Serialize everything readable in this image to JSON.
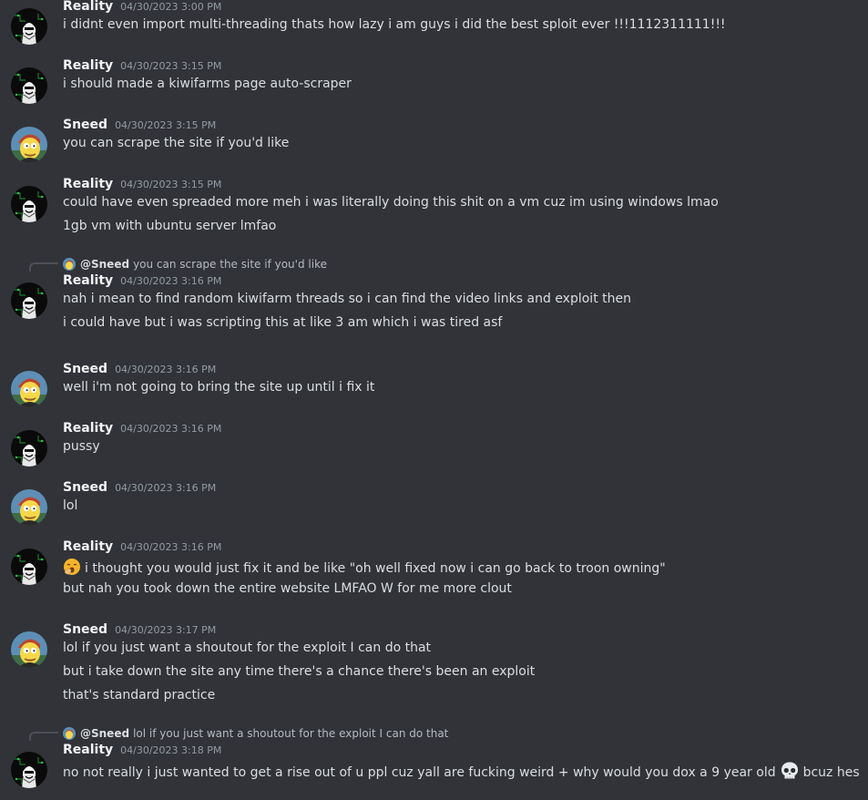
{
  "messages": [
    {
      "author": "Reality",
      "avatar": "reality",
      "timestamp": "04/30/2023 3:00 PM",
      "lines": [
        "i didnt even import multi-threading thats how lazy i am guys i did the best sploit ever !!!1112311111!!!"
      ]
    },
    {
      "author": "Reality",
      "avatar": "reality",
      "timestamp": "04/30/2023 3:15 PM",
      "lines": [
        "i should made a kiwifarms page auto-scraper"
      ]
    },
    {
      "author": "Sneed",
      "avatar": "sneed",
      "timestamp": "04/30/2023 3:15 PM",
      "lines": [
        "you can scrape the site if you'd like"
      ]
    },
    {
      "author": "Reality",
      "avatar": "reality",
      "timestamp": "04/30/2023 3:15 PM",
      "lines": [
        "could have even spreaded more meh i was literally doing this shit on a vm cuz im using windows lmao",
        "1gb vm with ubuntu server lmfao"
      ]
    },
    {
      "author": "Reality",
      "avatar": "reality",
      "timestamp": "04/30/2023 3:16 PM",
      "reply": {
        "name": "@Sneed",
        "text": "you can scrape the site if you'd like"
      },
      "lines": [
        "nah i mean to find random kiwifarm threads so i can find the video links and exploit then",
        "i could have but i was scripting this at like 3 am which i was tired asf"
      ]
    },
    {
      "author": "Sneed",
      "avatar": "sneed",
      "timestamp": "04/30/2023 3:16 PM",
      "lines": [
        "well i'm not going to bring the site up until i fix it"
      ]
    },
    {
      "author": "Reality",
      "avatar": "reality",
      "timestamp": "04/30/2023 3:16 PM",
      "lines": [
        "pussy"
      ]
    },
    {
      "author": "Sneed",
      "avatar": "sneed",
      "timestamp": "04/30/2023 3:16 PM",
      "lines": [
        "lol"
      ]
    },
    {
      "author": "Reality",
      "avatar": "reality",
      "timestamp": "04/30/2023 3:16 PM",
      "lines": [
        "i thought you would just fix it and be like \"oh well fixed now i can go back to troon owning\"",
        "but nah you took down the entire website LMFAO W for me more clout"
      ],
      "lead_emoji": "yawning-face-emoji"
    },
    {
      "author": "Sneed",
      "avatar": "sneed",
      "timestamp": "04/30/2023 3:17 PM",
      "lines": [
        "lol if you just want a shoutout for the exploit I can do that",
        "but i take down the site any time there's a chance there's been an exploit",
        "that's standard practice"
      ]
    },
    {
      "author": "Reality",
      "avatar": "reality",
      "timestamp": "04/30/2023 3:18 PM",
      "reply": {
        "name": "@Sneed",
        "text": "lol if you just want a shoutout for the exploit I can do that"
      },
      "lines": [
        "no not really i just wanted to get a rise out of u ppl cuz yall are fucking weird + why would you dox a 9 year old"
      ],
      "tail": "bcuz hes",
      "tail_emoji": "skull-emoji"
    }
  ],
  "colors": {
    "background": "#313338",
    "author": "#f2f3f5",
    "timestamp": "#949ba4",
    "text": "#dbdee1"
  }
}
